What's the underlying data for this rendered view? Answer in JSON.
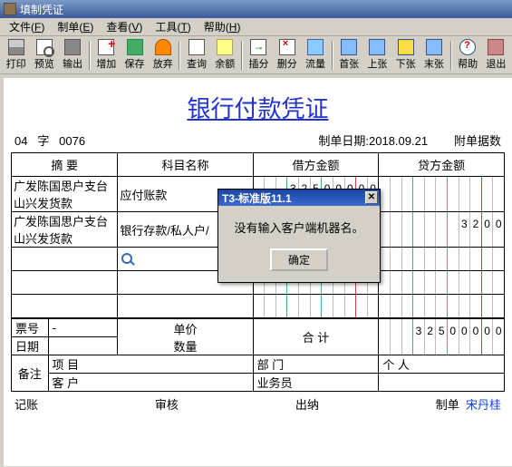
{
  "window": {
    "title": "填制凭证"
  },
  "menu": {
    "file": "文件",
    "file_k": "F",
    "make": "制单",
    "make_k": "E",
    "view": "查看",
    "view_k": "V",
    "tool": "工具",
    "tool_k": "T",
    "help": "帮助",
    "help_k": "H"
  },
  "toolbar": {
    "print": "打印",
    "preview": "预览",
    "export": "输出",
    "add": "增加",
    "save": "保存",
    "undo": "放弃",
    "find": "查询",
    "balance": "余额",
    "insert": "插分",
    "delete": "删分",
    "flow": "流量",
    "first": "首张",
    "prev": "上张",
    "next": "下张",
    "last": "末张",
    "help": "帮助",
    "exit": "退出"
  },
  "doc": {
    "title": "银行付款凭证",
    "word": "04",
    "word_label": "字",
    "number": "0076",
    "date_label": "制单日期:",
    "date": "2018.09.21",
    "attach_label": "附单据数"
  },
  "headers": {
    "summary": "摘 要",
    "subject": "科目名称",
    "debit": "借方金额",
    "credit": "贷方金额"
  },
  "rows": [
    {
      "summary": "广发陈国思户支台山兴发货款",
      "subject": "应付账款",
      "debit": "325000",
      "credit": ""
    },
    {
      "summary": "广发陈国思户支台山兴发货款",
      "subject": "银行存款/私人户/",
      "debit": "",
      "credit": "32"
    }
  ],
  "footer": {
    "ticket_label": "票号",
    "ticket": "-",
    "date_label": "日期",
    "price_label": "单价",
    "qty_label": "数量",
    "total_label": "合 计",
    "total_debit": "325000",
    "total_credit": "",
    "remark_label": "备注",
    "project_label": "项 目",
    "dept_label": "部 门",
    "person_label": "个 人",
    "customer_label": "客 户",
    "staff_label": "业务员"
  },
  "signs": {
    "bookkeep": "记账",
    "audit": "审核",
    "cashier": "出纳",
    "maker": "制单",
    "maker_name": "宋丹桂"
  },
  "dialog": {
    "title": "T3-标准版11.1",
    "message": "没有输入客户端机器名。",
    "ok": "确定"
  }
}
